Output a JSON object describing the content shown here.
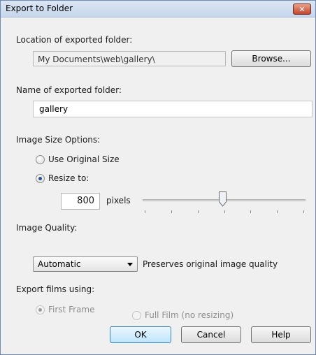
{
  "window": {
    "title": "Export to Folder",
    "close_glyph": "✕"
  },
  "location": {
    "label": "Location of exported folder:",
    "value": "My Documents\\web\\gallery\\",
    "browse_label": "Browse..."
  },
  "name": {
    "label": "Name of exported folder:",
    "value": "gallery"
  },
  "size": {
    "label": "Image Size Options:",
    "use_original_label": "Use Original Size",
    "resize_label": "Resize to:",
    "selected": "resize",
    "pixels_value": "800",
    "pixels_unit": "pixels",
    "slider_level": 0.49,
    "slider_tick_count": 7
  },
  "quality": {
    "label": "Image Quality:",
    "selected": "Automatic",
    "description": "Preserves original image quality"
  },
  "films": {
    "label": "Export films using:",
    "first_frame_label": "First Frame",
    "full_film_label": "Full Film (no resizing)",
    "selected": "first_frame",
    "disabled": true
  },
  "footer": {
    "ok_label": "OK",
    "cancel_label": "Cancel",
    "help_label": "Help"
  },
  "icons": {
    "close": "close-icon",
    "dropdown": "chevron-down-icon",
    "slider": "slider-thumb-icon"
  }
}
